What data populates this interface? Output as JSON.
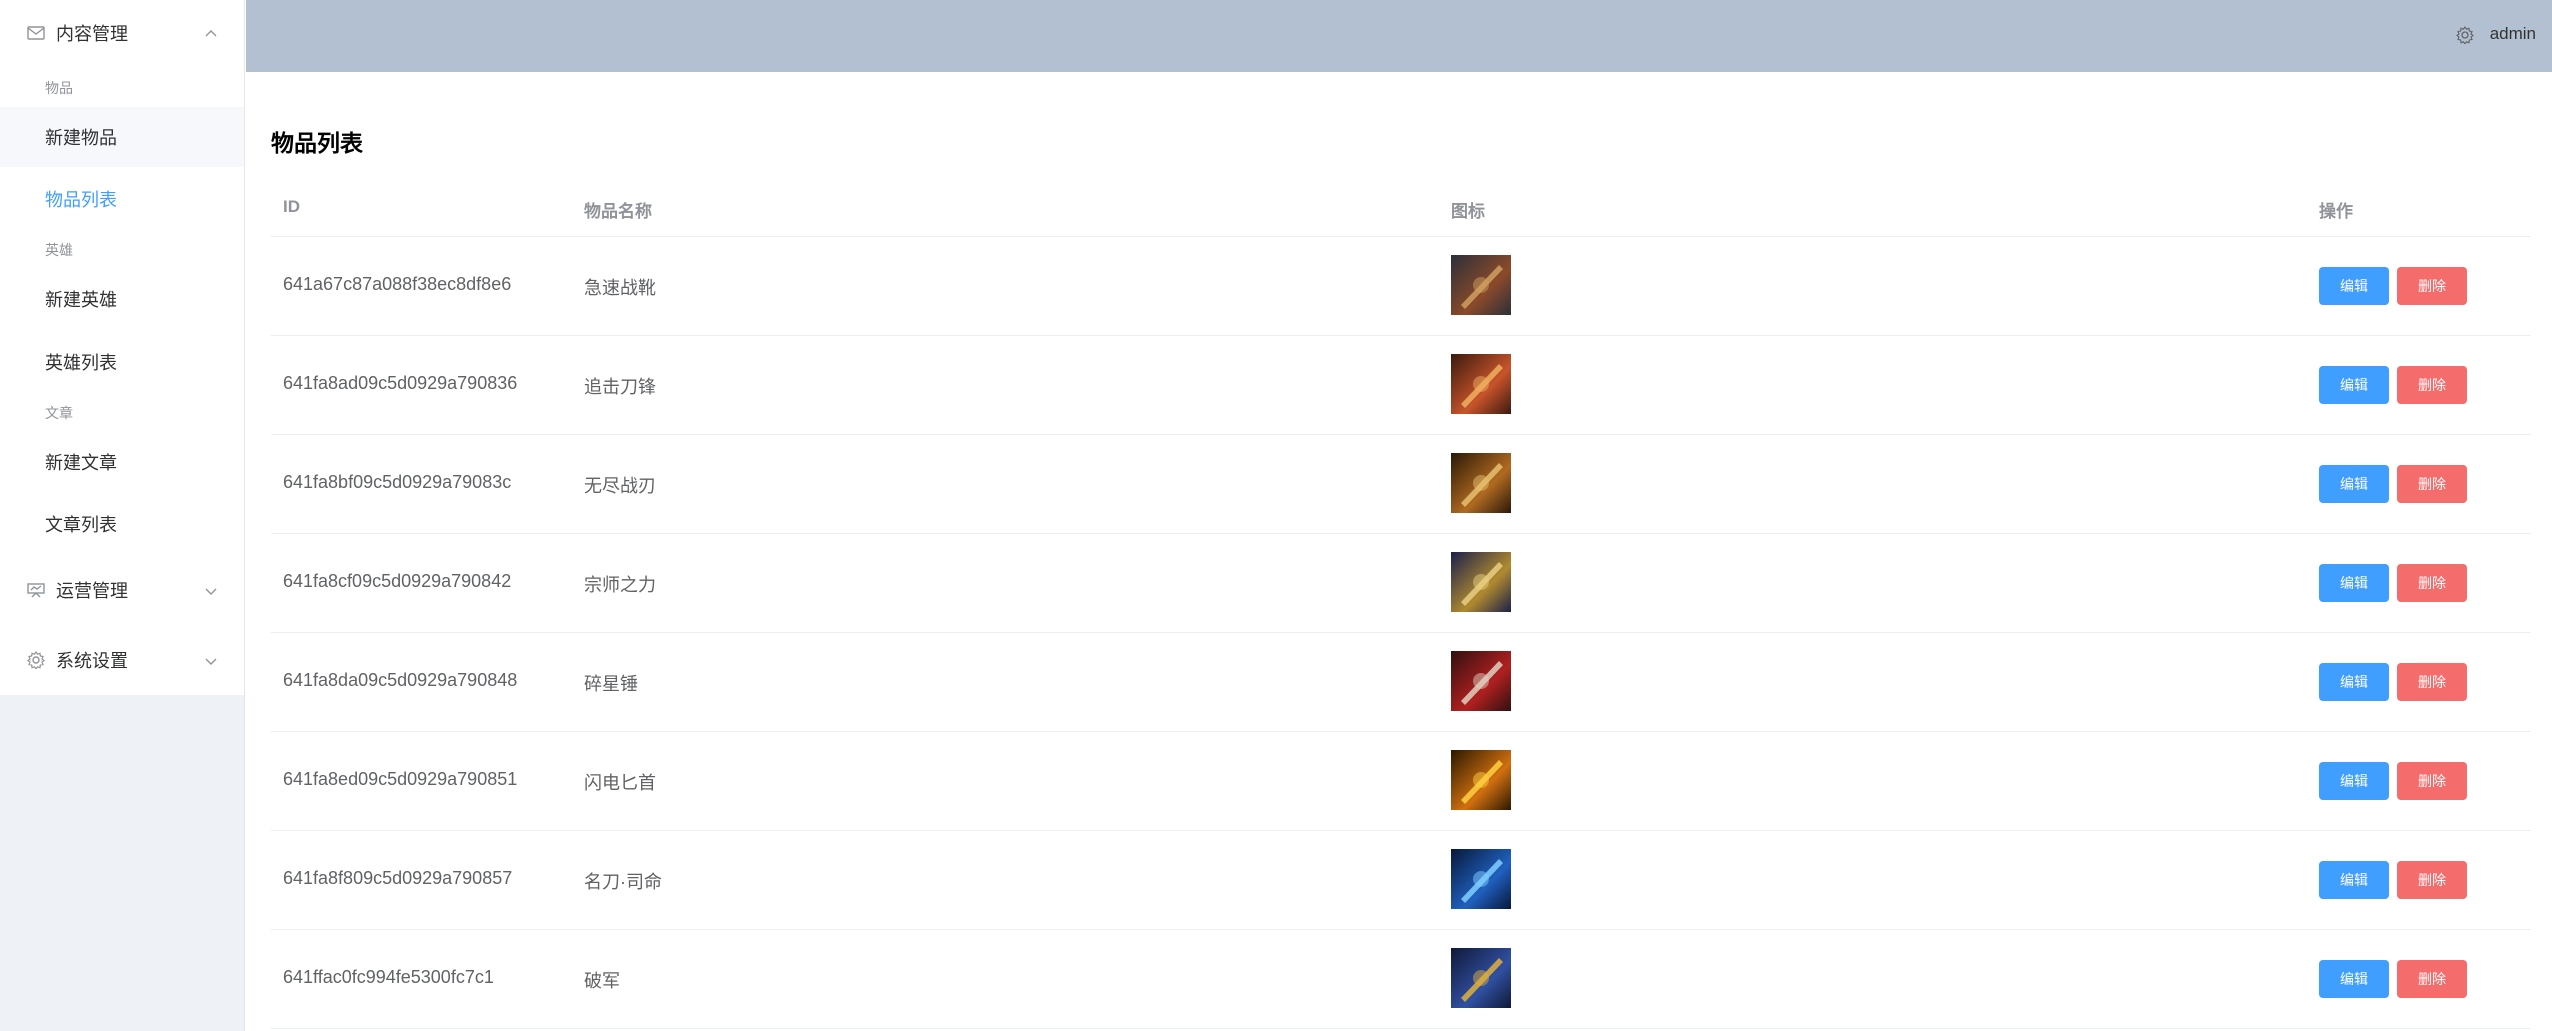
{
  "header": {
    "user": "admin",
    "settings_icon": "gear-icon",
    "background": "#b3c0d1"
  },
  "sidebar": {
    "content_menu": {
      "title": "内容管理",
      "icon": "mail-icon",
      "expanded": true
    },
    "groups": [
      {
        "title": "物品",
        "items": [
          "新建物品",
          "物品列表"
        ]
      },
      {
        "title": "英雄",
        "items": [
          "新建英雄",
          "英雄列表"
        ]
      },
      {
        "title": "文章",
        "items": [
          "新建文章",
          "文章列表"
        ]
      }
    ],
    "active_item": "物品列表",
    "ops_menu": {
      "title": "运营管理",
      "icon": "presentation-icon"
    },
    "settings_menu": {
      "title": "系统设置",
      "icon": "gear-icon"
    }
  },
  "main": {
    "title": "物品列表",
    "columns": [
      "ID",
      "物品名称",
      "图标",
      "操作"
    ],
    "edit_label": "编辑",
    "delete_label": "删除",
    "rows": [
      {
        "id": "641a67c87a088f38ec8df8e6",
        "name": "急速战靴",
        "icon": "boots-icon"
      },
      {
        "id": "641fa8ad09c5d0929a790836",
        "name": "追击刀锋",
        "icon": "blade-icon"
      },
      {
        "id": "641fa8bf09c5d0929a79083c",
        "name": "无尽战刃",
        "icon": "sword-icon"
      },
      {
        "id": "641fa8cf09c5d0929a790842",
        "name": "宗师之力",
        "icon": "star-icon"
      },
      {
        "id": "641fa8da09c5d0929a790848",
        "name": "碎星锤",
        "icon": "hammer-icon"
      },
      {
        "id": "641fa8ed09c5d0929a790851",
        "name": "闪电匕首",
        "icon": "lightning-dagger-icon"
      },
      {
        "id": "641fa8f809c5d0929a790857",
        "name": "名刀·司命",
        "icon": "katana-icon"
      },
      {
        "id": "641ffac0fc994fe5300fc7c1",
        "name": "破军",
        "icon": "greatsword-icon"
      }
    ]
  },
  "colors": {
    "primary": "#409eff",
    "danger": "#f56c6c",
    "active_text": "#409eff"
  }
}
